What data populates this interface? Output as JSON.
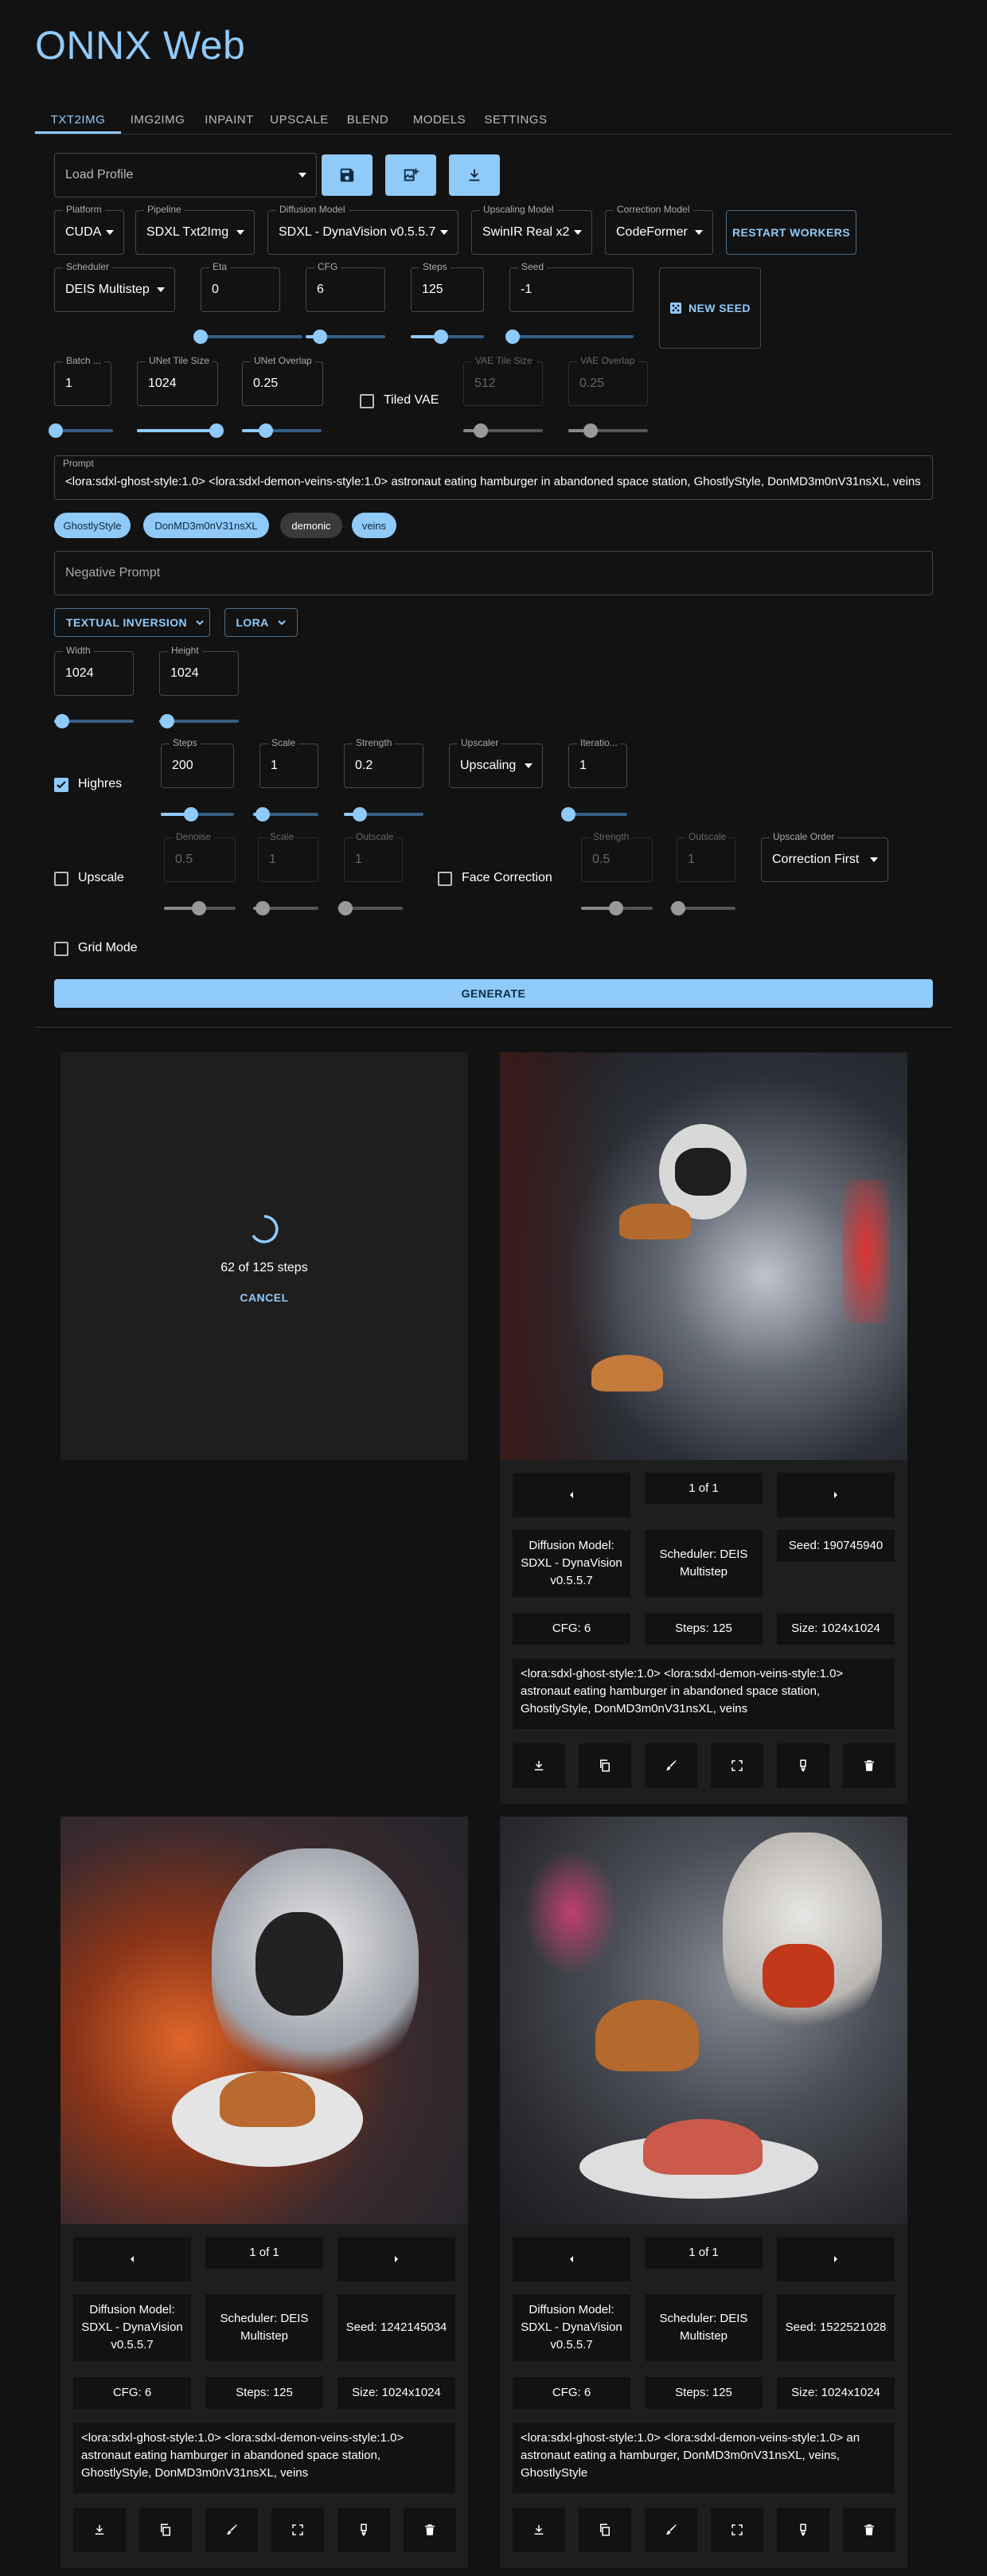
{
  "app": {
    "title": "ONNX Web"
  },
  "tabs": [
    "TXT2IMG",
    "IMG2IMG",
    "INPAINT",
    "UPSCALE",
    "BLEND",
    "MODELS",
    "SETTINGS"
  ],
  "profile": {
    "placeholder": "Load Profile"
  },
  "platform": {
    "label": "Platform",
    "value": "CUDA"
  },
  "pipeline": {
    "label": "Pipeline",
    "value": "SDXL Txt2Img"
  },
  "diffusion_model": {
    "label": "Diffusion Model",
    "value": "SDXL - DynaVision v0.5.5.7"
  },
  "upscaling_model": {
    "label": "Upscaling Model",
    "value": "SwinIR Real x2"
  },
  "correction_model": {
    "label": "Correction Model",
    "value": "CodeFormer"
  },
  "restart_workers_label": "RESTART WORKERS",
  "scheduler": {
    "label": "Scheduler",
    "value": "DEIS Multistep"
  },
  "eta": {
    "label": "Eta",
    "value": "0"
  },
  "cfg": {
    "label": "CFG",
    "value": "6"
  },
  "steps": {
    "label": "Steps",
    "value": "125"
  },
  "seed": {
    "label": "Seed",
    "value": "-1"
  },
  "new_seed_label": "NEW SEED",
  "batch": {
    "label": "Batch ...",
    "value": "1"
  },
  "unet_tile_size": {
    "label": "UNet Tile Size",
    "value": "1024"
  },
  "unet_overlap": {
    "label": "UNet Overlap",
    "value": "0.25"
  },
  "tiled_vae_label": "Tiled VAE",
  "vae_tile_size": {
    "label": "VAE Tile Size",
    "value": "512"
  },
  "vae_overlap": {
    "label": "VAE Overlap",
    "value": "0.25"
  },
  "prompt": {
    "label": "Prompt",
    "value": "<lora:sdxl-ghost-style:1.0> <lora:sdxl-demon-veins-style:1.0> astronaut eating hamburger in abandoned space station, GhostlyStyle, DonMD3m0nV31nsXL, veins"
  },
  "prompt_chips": [
    "GhostlyStyle",
    "DonMD3m0nV31nsXL",
    "demonic",
    "veins"
  ],
  "negative_prompt": {
    "placeholder": "Negative Prompt"
  },
  "textual_inversion_label": "TEXTUAL INVERSION",
  "lora_label": "LORA",
  "width": {
    "label": "Width",
    "value": "1024"
  },
  "height": {
    "label": "Height",
    "value": "1024"
  },
  "highres": {
    "label": "Highres",
    "steps": {
      "label": "Steps",
      "value": "200"
    },
    "scale": {
      "label": "Scale",
      "value": "1"
    },
    "strength": {
      "label": "Strength",
      "value": "0.2"
    },
    "upscaler": {
      "label": "Upscaler",
      "value": "Upscaling"
    },
    "iterations": {
      "label": "Iteratio...",
      "value": "1"
    }
  },
  "upscale": {
    "label": "Upscale",
    "denoise": {
      "label": "Denoise",
      "value": "0.5"
    },
    "scale": {
      "label": "Scale",
      "value": "1"
    },
    "outscale": {
      "label": "Outscale",
      "value": "1"
    }
  },
  "face_correction": {
    "label": "Face Correction",
    "strength": {
      "label": "Strength",
      "value": "0.5"
    },
    "outscale": {
      "label": "Outscale",
      "value": "1"
    },
    "upscale_order": {
      "label": "Upscale Order",
      "value": "Correction First"
    }
  },
  "grid_mode_label": "Grid Mode",
  "generate_label": "GENERATE",
  "progress": {
    "text": "62 of 125 steps",
    "cancel_label": "CANCEL"
  },
  "results": [
    {
      "page": "1 of 1",
      "model": "Diffusion Model: SDXL - DynaVision v0.5.5.7",
      "scheduler": "Scheduler: DEIS Multistep",
      "seed": "Seed: 190745940",
      "cfg": "CFG: 6",
      "steps": "Steps: 125",
      "size": "Size: 1024x1024",
      "prompt": "<lora:sdxl-ghost-style:1.0> <lora:sdxl-demon-veins-style:1.0> astronaut eating hamburger in abandoned space station, GhostlyStyle, DonMD3m0nV31nsXL, veins"
    },
    {
      "page": "1 of 1",
      "model": "Diffusion Model: SDXL - DynaVision v0.5.5.7",
      "scheduler": "Scheduler: DEIS Multistep",
      "seed": "Seed: 1242145034",
      "cfg": "CFG: 6",
      "steps": "Steps: 125",
      "size": "Size: 1024x1024",
      "prompt": "<lora:sdxl-ghost-style:1.0> <lora:sdxl-demon-veins-style:1.0> astronaut eating hamburger in abandoned space station, GhostlyStyle, DonMD3m0nV31nsXL, veins"
    },
    {
      "page": "1 of 1",
      "model": "Diffusion Model: SDXL - DynaVision v0.5.5.7",
      "scheduler": "Scheduler: DEIS Multistep",
      "seed": "Seed: 1522521028",
      "cfg": "CFG: 6",
      "steps": "Steps: 125",
      "size": "Size: 1024x1024",
      "prompt": "<lora:sdxl-ghost-style:1.0> <lora:sdxl-demon-veins-style:1.0> an astronaut eating a hamburger, DonMD3m0nV31nsXL, veins, GhostlyStyle"
    }
  ],
  "icons": [
    "save-icon",
    "image-import-icon",
    "download-icon",
    "dice-icon",
    "chevron-down-icon",
    "arrow-left-icon",
    "arrow-right-icon",
    "copy-icon",
    "brush-icon",
    "fullscreen-icon",
    "eraser-icon",
    "delete-icon"
  ],
  "colors": {
    "accent": "#90caf9",
    "background": "#121212",
    "card": "#1e1e1e"
  }
}
